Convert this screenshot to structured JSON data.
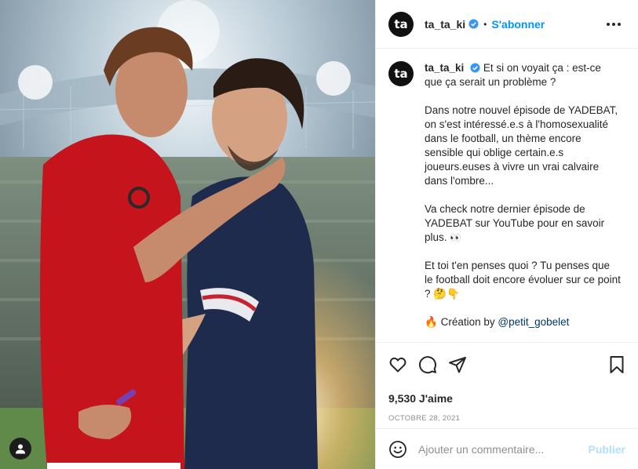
{
  "post": {
    "image_alt": "Two football players embracing in a stadium",
    "user_tag_icon": "user-icon"
  },
  "header": {
    "avatar_text": "ta",
    "username": "ta_ta_ki",
    "verified_icon": "verified-badge-icon",
    "separator": "•",
    "follow_label": "S'abonner",
    "more_icon": "more-options-icon"
  },
  "caption": {
    "avatar_text": "ta",
    "username": "ta_ta_ki",
    "line1": "Et si on voyait ça : est-ce que ça serait un problème ?",
    "para2": "Dans notre nouvel épisode de YADEBAT, on s'est intéressé.e.s à l'homosexualité dans le football, un thème encore sensible qui oblige certain.e.s joueurs.euses à vivre un vrai calvaire dans l'ombre...",
    "para3": "Va check notre dernier épisode de YADEBAT sur YouTube pour en savoir plus.",
    "para3_emoji": "👀",
    "para4": "Et toi t'en penses quoi ? Tu penses que le football doit encore évoluer sur ce point ?",
    "para4_emoji": "🤔👇",
    "credit_emoji": "🔥",
    "credit_prefix": "Création by",
    "credit_mention": "@petit_gobelet"
  },
  "actions": {
    "like_icon": "heart-icon",
    "comment_icon": "comment-icon",
    "share_icon": "share-icon",
    "save_icon": "bookmark-icon",
    "likes": "9,530 J'aime",
    "date": "OCTOBRE 28, 2021"
  },
  "comment_box": {
    "emoji_icon": "smiley-icon",
    "placeholder": "Ajouter un commentaire...",
    "publish_label": "Publier"
  },
  "colors": {
    "accent": "#0095f6",
    "publish_disabled": "#b2dffc",
    "mention": "#00376b",
    "muted": "#8e8e8e"
  }
}
